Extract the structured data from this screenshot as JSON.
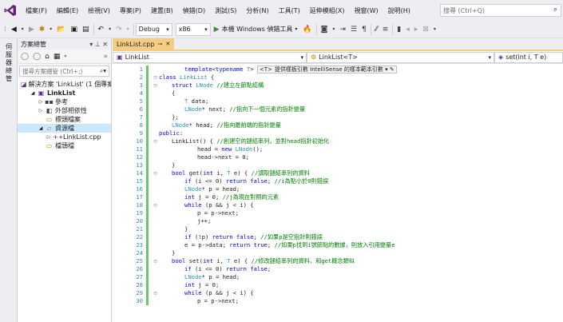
{
  "menu": {
    "items": [
      "檔案(F)",
      "編輯(E)",
      "檢視(V)",
      "專案(P)",
      "建置(B)",
      "偵錯(D)",
      "測試(S)",
      "分析(N)",
      "工具(T)",
      "延伸模組(X)",
      "視窗(W)",
      "說明(H)"
    ],
    "search_placeholder": "搜尋 (Ctrl+Q)"
  },
  "toolbar": {
    "config": "Debug",
    "platform": "x86",
    "run_label": "本機 Windows 偵錯工具"
  },
  "left_tab": {
    "label": "伺服器總管"
  },
  "solution_explorer": {
    "title": "方案總管",
    "pin": "▾ ⊥ ✕",
    "search_placeholder": "搜尋方案總管 (Ctrl+;)",
    "tree": [
      {
        "label": "解決方案 'LinkList' (1 個專案",
        "icon": "solution-icon",
        "depth": 0,
        "expander": ""
      },
      {
        "label": "LinkList",
        "icon": "project-icon",
        "depth": 1,
        "expander": "◢"
      },
      {
        "label": "參考",
        "icon": "references-icon",
        "depth": 2,
        "expander": "▷"
      },
      {
        "label": "外部相依性",
        "icon": "external-deps-icon",
        "depth": 2,
        "expander": "▷"
      },
      {
        "label": "標頭檔案",
        "icon": "folder-icon",
        "depth": 2,
        "expander": ""
      },
      {
        "label": "資源檔",
        "icon": "folder-open-icon",
        "depth": 2,
        "expander": "◢"
      },
      {
        "label": "LinkList.cpp",
        "icon": "cpp-file-icon",
        "depth": 3,
        "expander": "▷"
      },
      {
        "label": "檔頭檔",
        "icon": "folder-icon",
        "depth": 2,
        "expander": ""
      }
    ]
  },
  "editor": {
    "tab_label": "LinkList.cpp",
    "nav_project": "LinkList",
    "nav_class": "LinkList<T>",
    "nav_member": "set(int i, T e)",
    "hint_label": "<T>",
    "hint_text": "提供樣板引數 IntelliSense 的樣本範本引數 ▾ ✎"
  },
  "code_lines": [
    {
      "n": "1",
      "indent": 2,
      "html": "<span class='k'>template</span>&lt;<span class='k'>typename</span> <span class='t'>T</span>&gt; "
    },
    {
      "n": "2",
      "indent": 0,
      "html": "<span class='k'>class</span> <span class='t'>LinkList</span> {"
    },
    {
      "n": "3",
      "indent": 1,
      "html": "<span class='k'>struct</span> <span class='t'>LNode</span> <span class='c'>//建立左節點結構</span>"
    },
    {
      "n": "4",
      "indent": 1,
      "html": "{"
    },
    {
      "n": "5",
      "indent": 2,
      "html": "<span class='t'>T</span> data;"
    },
    {
      "n": "6",
      "indent": 2,
      "html": "<span class='t'>LNode</span>* next; <span class='c'>//指向下一個元素的指針變量</span>"
    },
    {
      "n": "7",
      "indent": 1,
      "html": "};"
    },
    {
      "n": "8",
      "indent": 1,
      "html": "<span class='t'>LNode</span>* head; <span class='c'>//指向最前端的指針變量</span>"
    },
    {
      "n": "9",
      "indent": 0,
      "html": "<span class='k'>public</span>:"
    },
    {
      "n": "10",
      "indent": 1,
      "html": "LinkList() { <span class='c'>//創建空的鏈結串列，並對head指針初始化</span>"
    },
    {
      "n": "11",
      "indent": 3,
      "html": "head = <span class='k'>new</span> <span class='t'>LNode</span>();"
    },
    {
      "n": "12",
      "indent": 3,
      "html": "head-&gt;next = 0;"
    },
    {
      "n": "13",
      "indent": 1,
      "html": "}"
    },
    {
      "n": "14",
      "indent": 1,
      "html": "<span class='k'>bool</span> get(<span class='k'>int</span> i, <span class='t'>T</span> e) { <span class='c'>//讀取鏈結串列的資料</span>"
    },
    {
      "n": "15",
      "indent": 2,
      "html": "<span class='k'>if</span> (i &lt;= 0) <span class='k'>return</span> <span class='k'>false</span>; <span class='c'>//i為點小於0則錯誤</span>"
    },
    {
      "n": "16",
      "indent": 2,
      "html": "<span class='t'>LNode</span>* p = head;"
    },
    {
      "n": "17",
      "indent": 2,
      "html": "<span class='k'>int</span> j = 0; <span class='c'>//j為現在對照的元素</span>"
    },
    {
      "n": "18",
      "indent": 2,
      "html": "<span class='k'>while</span> (p &amp;&amp; j &lt; i) {"
    },
    {
      "n": "19",
      "indent": 3,
      "html": "p = p-&gt;next;"
    },
    {
      "n": "20",
      "indent": 3,
      "html": "j++;"
    },
    {
      "n": "21",
      "indent": 2,
      "html": "}"
    },
    {
      "n": "22",
      "indent": 2,
      "html": "<span class='k'>if</span> (!p) <span class='k'>return</span> <span class='k'>false</span>; <span class='c'>//如果p是空指針則錯誤</span>"
    },
    {
      "n": "23",
      "indent": 2,
      "html": "e = p-&gt;data; <span class='k'>return</span> <span class='k'>true</span>; <span class='c'>//如果p找到i號節點的數據，則放入引用變量e</span>"
    },
    {
      "n": "24",
      "indent": 1,
      "html": "}"
    },
    {
      "n": "25",
      "indent": 1,
      "html": "<span class='k'>bool</span> set(<span class='k'>int</span> i, <span class='t'>T</span> e) { <span class='c'>//修改鏈結串列的資料，和get概念類似</span>"
    },
    {
      "n": "26",
      "indent": 2,
      "html": "<span class='k'>if</span> (i &lt;= 0) <span class='k'>return</span> <span class='k'>false</span>;"
    },
    {
      "n": "27",
      "indent": 2,
      "html": "<span class='t'>LNode</span>* p = head;"
    },
    {
      "n": "28",
      "indent": 2,
      "html": "<span class='k'>int</span> j = 0;"
    },
    {
      "n": "29",
      "indent": 2,
      "html": "<span class='k'>while</span> (p &amp;&amp; j &lt; i) {"
    },
    {
      "n": "30",
      "indent": 3,
      "html": "p = p-&gt;next;"
    }
  ]
}
